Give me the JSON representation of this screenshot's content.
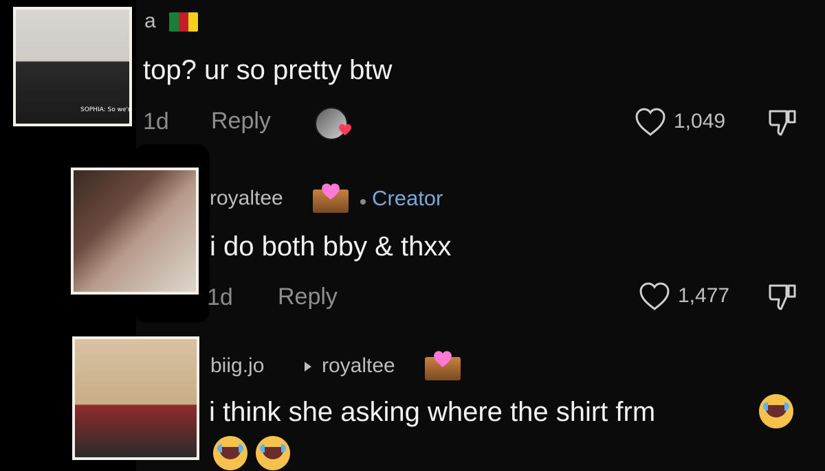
{
  "comments": [
    {
      "username": "a",
      "text": "top? ur so pretty btw",
      "age": "1d",
      "reply_label": "Reply",
      "likes": "1,049",
      "avatar_caption": "SOPHIA: So we're so"
    },
    {
      "username": "royaltee",
      "creator_label": "Creator",
      "text": "i do both bby & thxx",
      "age": "1d",
      "reply_label": "Reply",
      "likes": "1,477"
    },
    {
      "username": "biig.jo",
      "reply_to": "royaltee",
      "text": "i think she asking where the shirt frm"
    }
  ],
  "icons": {
    "like": "heart-outline-icon",
    "dislike": "thumbs-down-icon",
    "reply_arrow": "triangle-right-icon"
  },
  "colors": {
    "background": "#0b0b0b",
    "creator": "#7aa7d8",
    "heart": "#ff3b5c"
  }
}
